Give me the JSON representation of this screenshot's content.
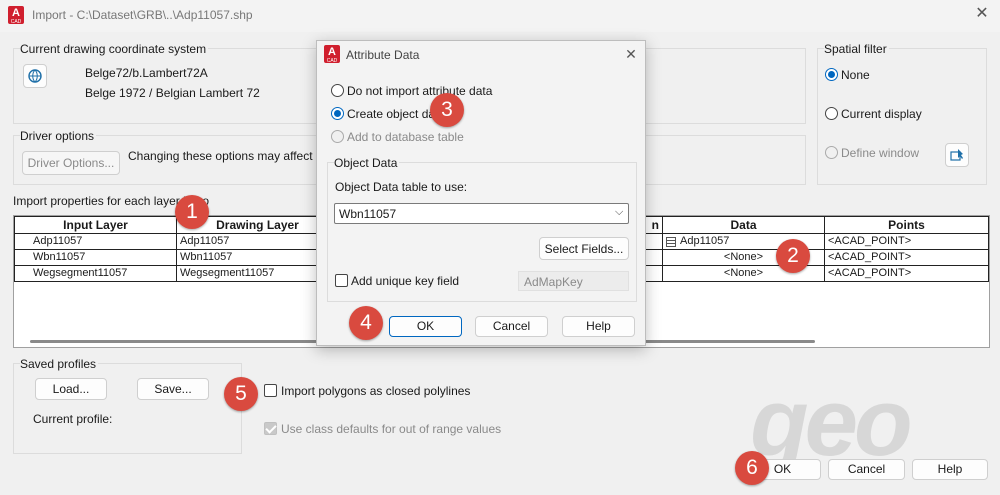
{
  "window": {
    "title": "Import - C:\\Dataset\\GRB\\..\\Adp11057.shp",
    "app_icon_letter": "A",
    "app_icon_sub": "CAD"
  },
  "coord": {
    "group_label": "Current drawing coordinate system",
    "code": "Belge72/b.Lambert72A",
    "description": "Belge 1972 / Belgian Lambert 72"
  },
  "driver": {
    "group_label": "Driver options",
    "button": "Driver Options...",
    "note": "Changing these options may affect the la"
  },
  "spatial": {
    "group_label": "Spatial filter",
    "none": "None",
    "current_display": "Current display",
    "define_window": "Define window"
  },
  "layers": {
    "group_label": "Import properties for each layer impo",
    "columns": [
      "Input Layer",
      "Drawing Layer",
      "n",
      "Data",
      "Points"
    ],
    "rows": [
      {
        "input": "Adp11057",
        "drawing": "Adp11057",
        "data": "Adp11057",
        "points": "<ACAD_POINT>"
      },
      {
        "input": "Wbn11057",
        "drawing": "Wbn11057",
        "data": "<None>",
        "points": "<ACAD_POINT>"
      },
      {
        "input": "Wegsegment11057",
        "drawing": "Wegsegment11057",
        "data": "<None>",
        "points": "<ACAD_POINT>"
      }
    ]
  },
  "profiles": {
    "group_label": "Saved profiles",
    "load": "Load...",
    "save": "Save...",
    "current_label": "Current profile:"
  },
  "options": {
    "polygons": "Import polygons as closed polylines",
    "class_defaults": "Use class defaults for out of range values"
  },
  "footer": {
    "ok": "OK",
    "cancel": "Cancel",
    "help": "Help"
  },
  "modal": {
    "title": "Attribute Data",
    "opt_none": "Do not import attribute data",
    "opt_object": "Create object data",
    "opt_db": "Add to database table",
    "group_label": "Object Data",
    "table_label": "Object Data table to use:",
    "table_value": "Wbn11057",
    "select_fields": "Select Fields...",
    "unique_key": "Add unique key field",
    "key_name": "AdMapKey",
    "ok": "OK",
    "cancel": "Cancel",
    "help": "Help"
  },
  "badges": [
    "1",
    "2",
    "3",
    "4",
    "5",
    "6"
  ],
  "watermark": "geo",
  "colors": {
    "accent": "#0067c0",
    "badge": "#d94a3f",
    "brand": "#d01f2e"
  }
}
